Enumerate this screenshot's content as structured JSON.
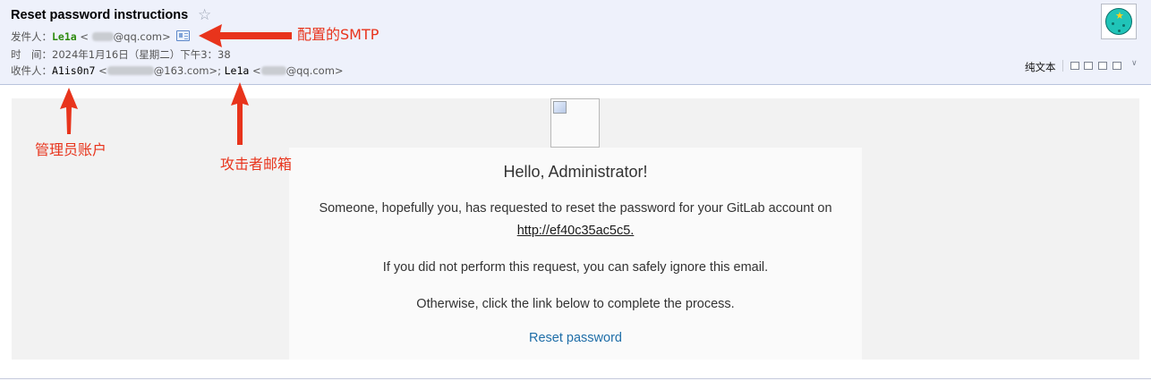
{
  "email": {
    "subject": "Reset password instructions",
    "star_icon": "☆",
    "from_label": "发件人：",
    "from_name": "Le1a",
    "from_addr_pre": "<",
    "from_addr_post": "@qq.com>",
    "time_label": "时　间：",
    "time_value": "2024年1月16日（星期二）下午3：38",
    "to_label": "收件人：",
    "to1_name": "A1is0n7",
    "to1_addr_pre": "<",
    "to1_addr_post": "@163.com>;",
    "to2_name": "Le1a",
    "to2_addr_pre": "<",
    "to2_addr_post": "@qq.com>",
    "plain_text_label": "纯文本"
  },
  "message": {
    "greeting": "Hello, Administrator!",
    "line1": "Someone, hopefully you, has requested to reset the password for your GitLab account on",
    "link": "http://ef40c35ac5c5.",
    "line2": "If you did not perform this request, you can safely ignore this email.",
    "line3": "Otherwise, click the link below to complete the process.",
    "reset_link": "Reset password"
  },
  "annotations": {
    "smtp": "配置的SMTP",
    "admin": "管理员账户",
    "attacker": "攻击者邮箱",
    "color": "#e8341c"
  },
  "colors": {
    "header_bg": "#eef1fb",
    "sender_green": "#2d8a0e",
    "link_blue": "#1f6ea8"
  }
}
